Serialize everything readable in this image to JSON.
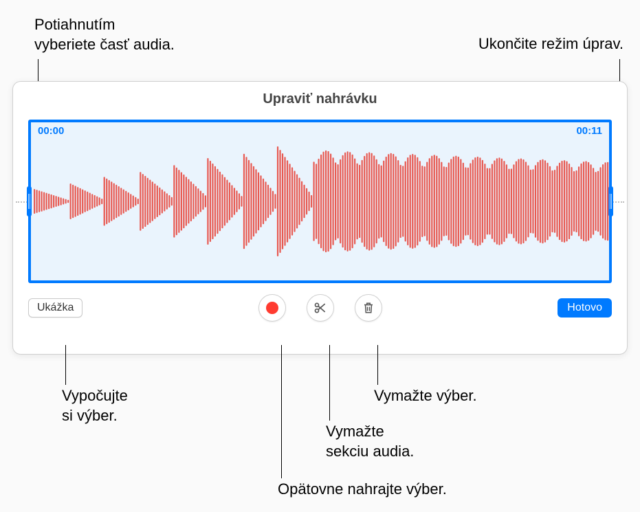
{
  "callouts": {
    "drag_select": "Potiahnutím\nvyberiete časť audia.",
    "exit_edit": "Ukončite režim úprav.",
    "listen": "Vypočujte\nsi výber.",
    "delete_section": "Vymažte\nsekciu audia.",
    "delete_selection": "Vymažte výber.",
    "rerecord": "Opätovne nahrajte výber."
  },
  "panel": {
    "title": "Upraviť nahrávku",
    "time_start": "00:00",
    "time_end": "00:11",
    "preview_button": "Ukážka",
    "done_button": "Hotovo"
  },
  "icons": {
    "record": "record-icon",
    "scissors": "scissors-icon",
    "trash": "trash-icon"
  },
  "colors": {
    "accent": "#007aff",
    "waveform": "#e85a52",
    "record": "#ff3b30"
  }
}
